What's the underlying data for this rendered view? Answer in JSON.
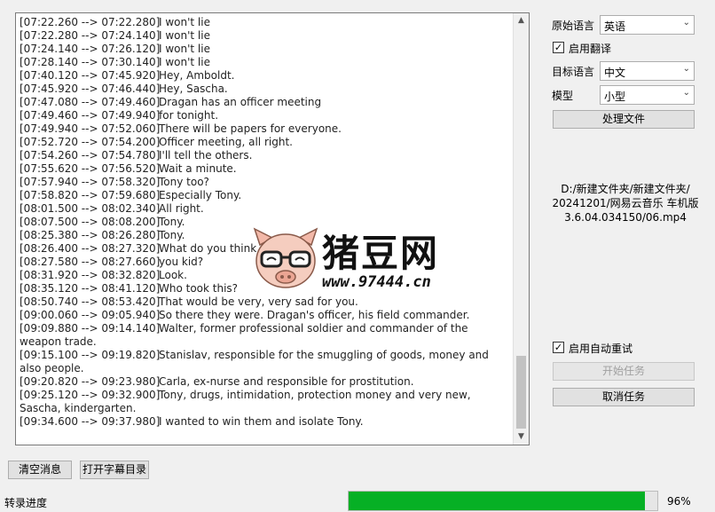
{
  "log": [
    {
      "ts": "[07:22.260 --> 07:22.280]",
      "text": "I won't lie"
    },
    {
      "ts": "[07:22.280 --> 07:24.140]",
      "text": "I won't lie"
    },
    {
      "ts": "[07:24.140 --> 07:26.120]",
      "text": "I won't lie"
    },
    {
      "ts": "[07:28.140 --> 07:30.140]",
      "text": "I won't lie"
    },
    {
      "ts": "[07:40.120 --> 07:45.920]",
      "text": "Hey, Amboldt."
    },
    {
      "ts": "[07:45.920 --> 07:46.440]",
      "text": "Hey, Sascha."
    },
    {
      "ts": "[07:47.080 --> 07:49.460]",
      "text": "Dragan has an officer meeting"
    },
    {
      "ts": "[07:49.460 --> 07:49.940]",
      "text": "for tonight."
    },
    {
      "ts": "[07:49.940 --> 07:52.060]",
      "text": "There will be papers for everyone."
    },
    {
      "ts": "[07:52.720 --> 07:54.200]",
      "text": "Officer meeting, all right."
    },
    {
      "ts": "[07:54.260 --> 07:54.780]",
      "text": "I'll tell the others."
    },
    {
      "ts": "[07:55.620 --> 07:56.520]",
      "text": "Wait a minute."
    },
    {
      "ts": "[07:57.940 --> 07:58.320]",
      "text": "Tony too?"
    },
    {
      "ts": "[07:58.820 --> 07:59.680]",
      "text": "Especially Tony."
    },
    {
      "ts": "[08:01.500 --> 08:02.340]",
      "text": "All right."
    },
    {
      "ts": "[08:07.500 --> 08:08.200]",
      "text": "Tony."
    },
    {
      "ts": "[08:25.380 --> 08:26.280]",
      "text": "Tony."
    },
    {
      "ts": "[08:26.400 --> 08:27.320]",
      "text": "What do you think,"
    },
    {
      "ts": "[08:27.580 --> 08:27.660]",
      "text": "you kid?"
    },
    {
      "ts": "[08:31.920 --> 08:32.820]",
      "text": "Look."
    },
    {
      "ts": "[08:35.120 --> 08:41.120]",
      "text": "Who took this?"
    },
    {
      "ts": "[08:50.740 --> 08:53.420]",
      "text": "That would be very, very sad for you."
    },
    {
      "ts": "[09:00.060 --> 09:05.940]",
      "text": "So there they were. Dragan's officer, his field commander."
    },
    {
      "ts": "[09:09.880 --> 09:14.140]",
      "text": "Walter, former professional soldier and commander of the weapon trade."
    },
    {
      "ts": "[09:15.100 --> 09:19.820]",
      "text": "Stanislav, responsible for the smuggling of goods, money and also people."
    },
    {
      "ts": "[09:20.820 --> 09:23.980]",
      "text": "Carla, ex-nurse and responsible for prostitution."
    },
    {
      "ts": "[09:25.120 --> 09:32.900]",
      "text": "Tony, drugs, intimidation, protection money and very new, Sascha, kindergarten."
    },
    {
      "ts": "[09:34.600 --> 09:37.980]",
      "text": "I wanted to win them and isolate Tony."
    }
  ],
  "watermark": {
    "text": "猪豆网",
    "url": "www.97444.cn"
  },
  "settings": {
    "source_lang_label": "原始语言",
    "source_lang_value": "英语",
    "enable_translate_label": "启用翻译",
    "target_lang_label": "目标语言",
    "target_lang_value": "中文",
    "model_label": "模型",
    "model_value": "小型",
    "process_file_label": "处理文件",
    "file_path_line1": "D:/新建文件夹/新建文件夹/",
    "file_path_line2": "20241201/网易云音乐 车机版",
    "file_path_line3": "3.6.04.034150/06.mp4",
    "auto_retry_label": "启用自动重试",
    "start_task_label": "开始任务",
    "cancel_task_label": "取消任务"
  },
  "bottom": {
    "clear_label": "清空消息",
    "open_dir_label": "打开字幕目录",
    "progress_label": "转录进度",
    "progress_text": "96%",
    "progress_value": 0.96
  },
  "colors": {
    "progress": "#06b025"
  }
}
